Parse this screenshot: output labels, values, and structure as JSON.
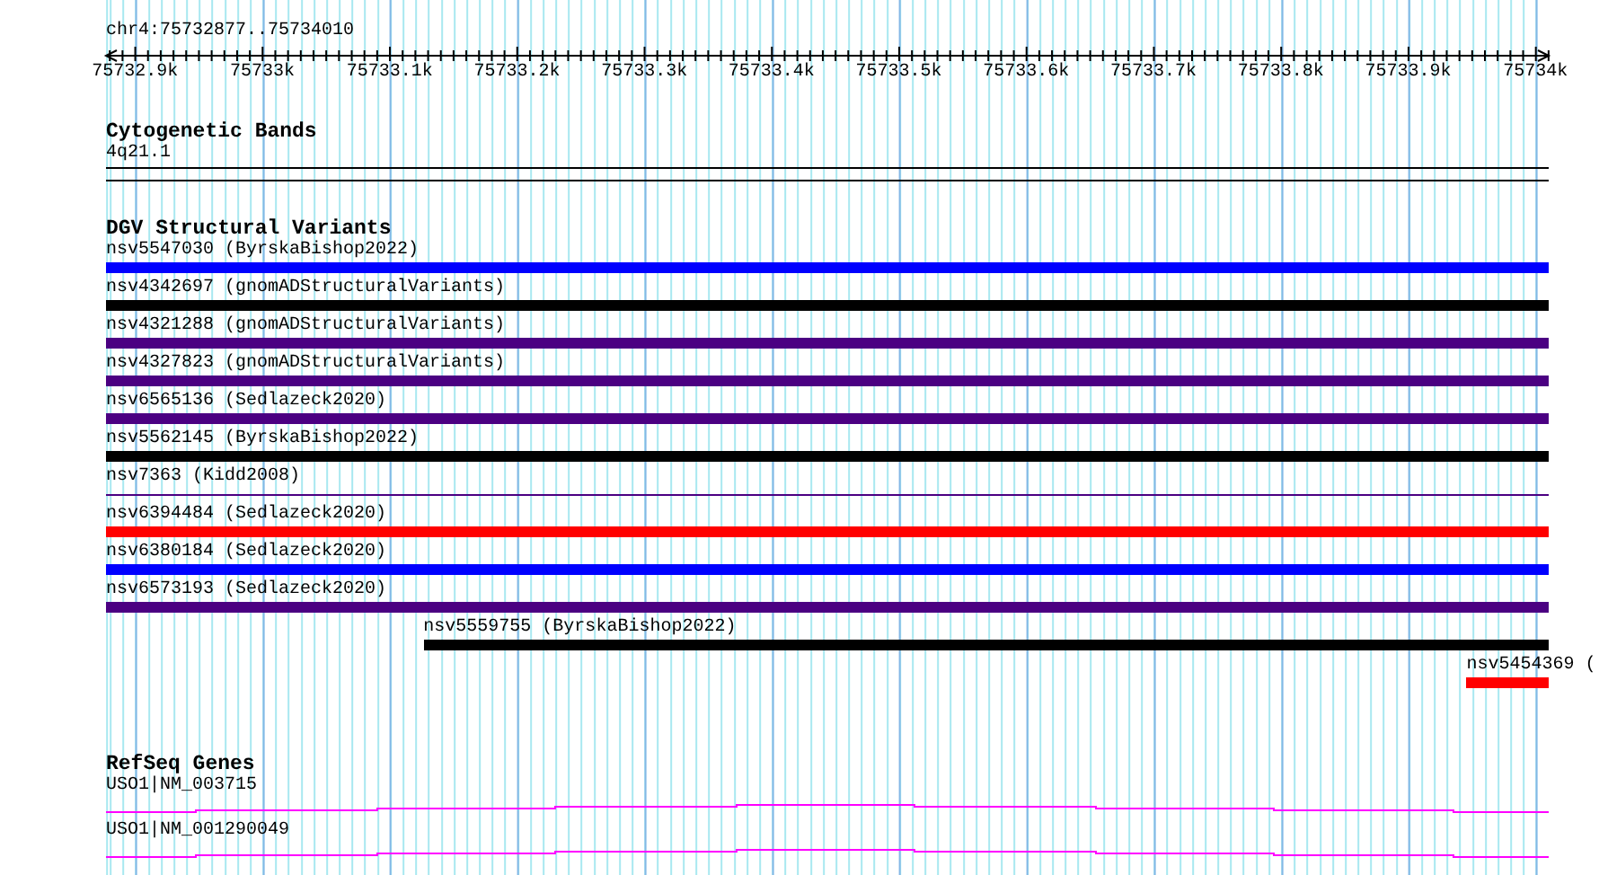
{
  "ruler": {
    "position": "chr4:75732877..75734010",
    "ticks": [
      "75732.9k",
      "75733k",
      "75733.1k",
      "75733.2k",
      "75733.3k",
      "75733.4k",
      "75733.5k",
      "75733.6k",
      "75733.7k",
      "75733.8k",
      "75733.9k",
      "75734k"
    ]
  },
  "cytogenetic_bands": {
    "title": "Cytogenetic Bands",
    "bands": [
      {
        "label": "4q21.1"
      }
    ]
  },
  "dgv_structural_variants": {
    "title": "DGV Structural Variants",
    "variants": [
      {
        "label": "nsv5547030 (ByrskaBishop2022)",
        "kind": "bar",
        "color": "#0000ff",
        "level": 1
      },
      {
        "label": "nsv4342697 (gnomADStructuralVariants)",
        "kind": "bar",
        "color": "#000000",
        "level": 1
      },
      {
        "label": "nsv4321288 (gnomADStructuralVariants)",
        "kind": "bar",
        "color": "#4b0082",
        "level": 1
      },
      {
        "label": "nsv4327823 (gnomADStructuralVariants)",
        "kind": "bar",
        "color": "#4b0082",
        "level": 1
      },
      {
        "label": "nsv6565136 (Sedlazeck2020)",
        "kind": "bar",
        "color": "#4b0082",
        "level": 1
      },
      {
        "label": "nsv5562145 (ByrskaBishop2022)",
        "kind": "bar",
        "color": "#000000",
        "level": 1
      },
      {
        "label": "nsv7363 (Kidd2008)",
        "kind": "line",
        "color": "#4b0082",
        "level": 1
      },
      {
        "label": "nsv6394484 (Sedlazeck2020)",
        "kind": "bar",
        "color": "#ff0000",
        "level": 1
      },
      {
        "label": "nsv6380184 (Sedlazeck2020)",
        "kind": "bar",
        "color": "#0000ff",
        "level": 1
      },
      {
        "label": "nsv6573193 (Sedlazeck2020)",
        "kind": "bar",
        "color": "#4b0082",
        "level": 1
      },
      {
        "label": "nsv5559755 (ByrskaBishop2022)",
        "kind": "bar",
        "color": "#000000",
        "level": 0.78
      },
      {
        "label": "nsv5454369 (",
        "kind": "bar",
        "color": "#ff0000",
        "level": 0.057
      }
    ]
  },
  "refseq_genes": {
    "title": "RefSeq Genes",
    "genes": [
      {
        "label": "USO1|NM_003715"
      },
      {
        "label": "USO1|NM_001290049"
      }
    ]
  }
}
